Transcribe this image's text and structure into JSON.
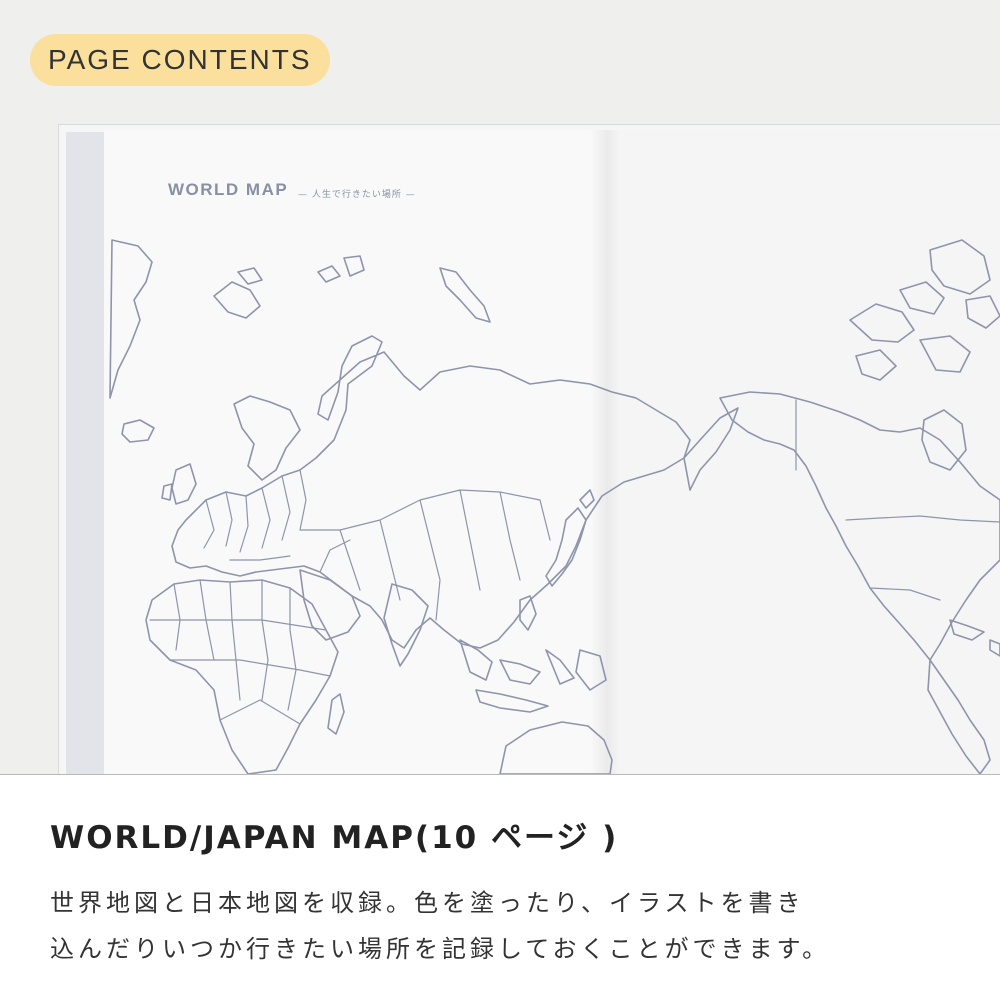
{
  "badge": {
    "label": "PAGE CONTENTS"
  },
  "book": {
    "map_title": "WORLD MAP",
    "map_subtitle": "— 人生で行きたい場所 —"
  },
  "section": {
    "heading": "WORLD/JAPAN MAP(10 ページ )",
    "description_lines": [
      "世界地図と日本地図を収録。色を塗ったり、イラストを書き",
      "込んだりいつか行きたい場所を記録しておくことができます。"
    ]
  },
  "colors": {
    "badge_bg": "#fbe09d",
    "map_line": "#8e95ab"
  }
}
